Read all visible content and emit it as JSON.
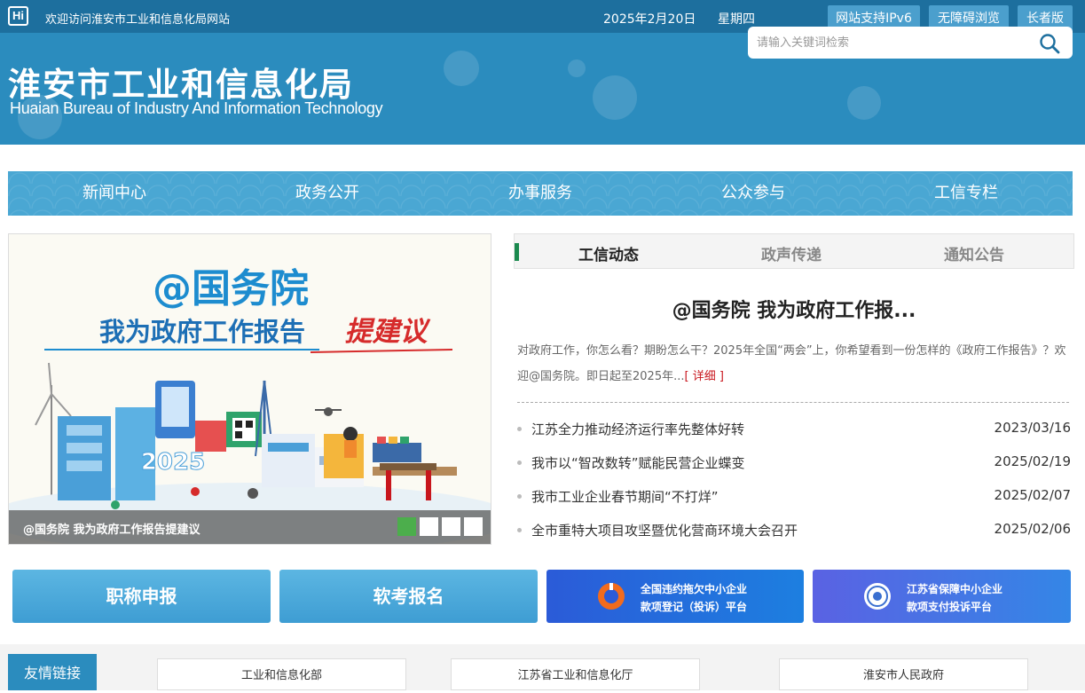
{
  "topbar": {
    "logo": "Hi",
    "welcome": "欢迎访问淮安市工业和信息化局网站",
    "date": "2025年2月20日",
    "weekday": "星期四",
    "buttons": [
      "网站支持IPv6",
      "无障碍浏览",
      "长者版"
    ]
  },
  "header": {
    "title": "淮安市工业和信息化局",
    "subtitle": "Huaian Bureau of Industry And Information Technology",
    "search_placeholder": "请输入关键词检索"
  },
  "nav": [
    "新闻中心",
    "政务公开",
    "办事服务",
    "公众参与",
    "工信专栏"
  ],
  "banner": {
    "heading_line1": "@国务院",
    "heading_line2": "我为政府工作报告",
    "heading_accent": "提建议",
    "year": "2025",
    "caption": "@国务院 我为政府工作报告提建议",
    "slide_count": 4,
    "active_slide": 1
  },
  "news": {
    "tabs": [
      "工信动态",
      "政声传递",
      "通知公告"
    ],
    "active_tab": 0,
    "headline": "@国务院 我为政府工作报...",
    "summary": "对政府工作，你怎么看？期盼怎么干？2025年全国“两会”上，你希望看到一份怎样的《政府工作报告》？欢迎@国务院。即日起至2025年...",
    "more": "[ 详细 ]",
    "items": [
      {
        "title": "江苏全力推动经济运行率先整体好转",
        "date": "2023/03/16"
      },
      {
        "title": "我市以“智改数转”赋能民营企业蝶变",
        "date": "2025/02/19"
      },
      {
        "title": "我市工业企业春节期间“不打烊”",
        "date": "2025/02/07"
      },
      {
        "title": "全市重特大项目攻坚暨优化营商环境大会召开",
        "date": "2025/02/06"
      }
    ]
  },
  "quick": {
    "title_apply": "职称申报",
    "exam_apply": "软考报名",
    "platform1": [
      "全国违约拖欠中小企业",
      "款项登记（投诉）平台"
    ],
    "platform2": [
      "江苏省保障中小企业",
      "款项支付投诉平台"
    ]
  },
  "links": {
    "label": "友情链接",
    "items": [
      "工业和信息化部",
      "江苏省工业和信息化厅",
      "淮安市人民政府"
    ]
  },
  "colors": {
    "topbar": "#1d6f9e",
    "header": "#2b8cbe",
    "nav": "#4aa7d3",
    "accent_green": "#4cae4c",
    "accent_red": "#c8161d"
  }
}
